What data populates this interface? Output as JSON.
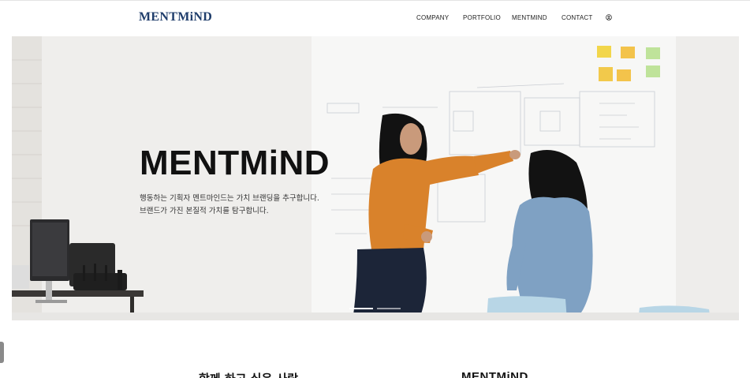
{
  "header": {
    "logo": "MENTMiND",
    "nav": [
      {
        "label": "COMPANY"
      },
      {
        "label": "PORTFOLIO"
      },
      {
        "label": "MENTMIND"
      },
      {
        "label": "CONTACT"
      }
    ],
    "user_icon": "user-circle-icon"
  },
  "hero": {
    "title": "MENTMiND",
    "line1": "행동하는 기획자 멘트마인드는 가치 브랜딩을 추구합니다.",
    "line2": "브랜드가 가진 본질적 가치를 탐구합니다.",
    "slides": 2,
    "active_slide": 1
  },
  "sections": {
    "left_heading": "함께 하고 싶은 사람",
    "right_heading": "MENTMiND"
  },
  "colors": {
    "logo": "#1f3d6b",
    "text": "#111111",
    "sticky_yellow": "#f2d64b",
    "sticky_green": "#bfe39a",
    "sweater": "#d9822b",
    "denim": "#7fa1c3"
  }
}
